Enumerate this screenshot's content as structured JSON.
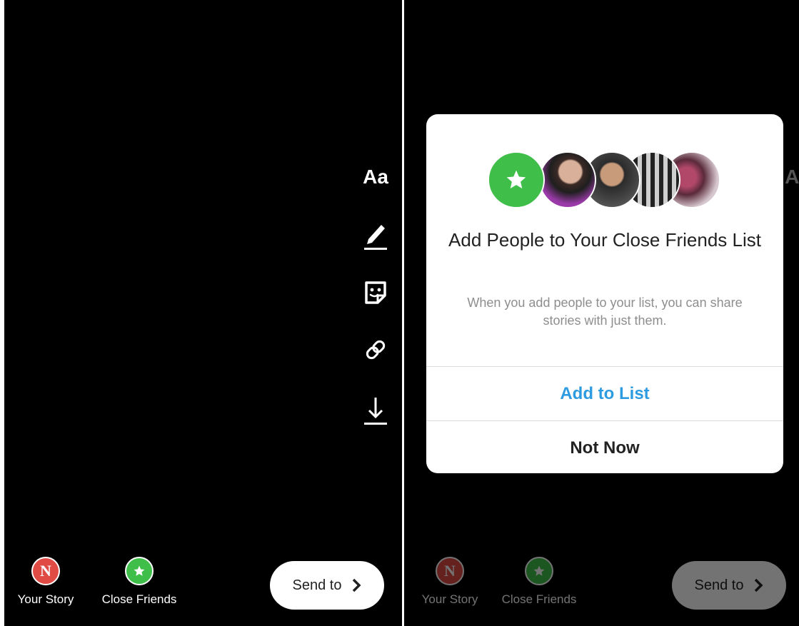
{
  "toolbar": {
    "text_tool_label": "Aa",
    "draw_icon": "pen-icon",
    "sticker_icon": "sticker-icon",
    "link_icon": "link-icon",
    "download_icon": "download-icon"
  },
  "bottom_bar": {
    "your_story_label": "Your Story",
    "your_story_badge": "N",
    "close_friends_label": "Close Friends",
    "send_to_label": "Send to",
    "send_to_icon": "chevron-right-icon"
  },
  "dialog": {
    "title": "Add People to Your Close Friends List",
    "description": "When you add people to your list, you can share stories with just them.",
    "primary_button": "Add to List",
    "secondary_button": "Not Now"
  },
  "colors": {
    "close_friends_green": "#3fbf4a",
    "your_story_red": "#e04b44",
    "primary_blue": "#2d9be0",
    "background": "#000000"
  }
}
